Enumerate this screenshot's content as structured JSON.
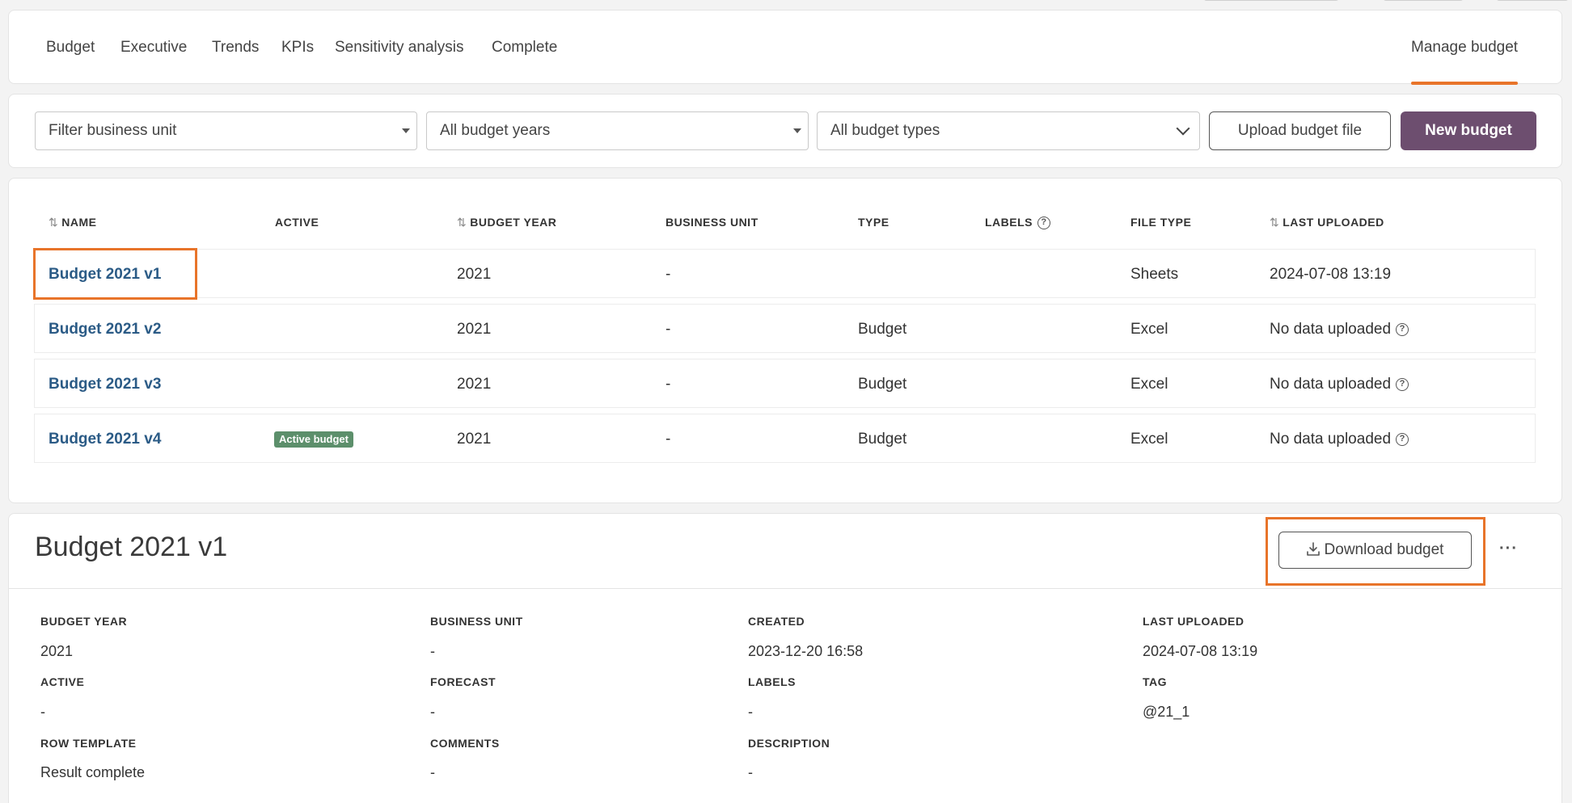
{
  "nav": {
    "tabs": [
      {
        "label": "Budget"
      },
      {
        "label": "Executive"
      },
      {
        "label": "Trends"
      },
      {
        "label": "KPIs"
      },
      {
        "label": "Sensitivity analysis"
      },
      {
        "label": "Complete"
      }
    ],
    "manage_label": "Manage budget"
  },
  "filters": {
    "business_unit": "Filter business unit",
    "budget_years": "All budget years",
    "budget_types": "All budget types",
    "upload_label": "Upload budget file",
    "new_label": "New budget"
  },
  "table": {
    "headers": {
      "name": "NAME",
      "active": "ACTIVE",
      "budget_year": "BUDGET YEAR",
      "business_unit": "BUSINESS UNIT",
      "type": "TYPE",
      "labels": "LABELS",
      "file_type": "FILE TYPE",
      "last_uploaded": "LAST UPLOADED"
    },
    "rows": [
      {
        "name": "Budget 2021 v1",
        "active": "",
        "year": "2021",
        "unit": "-",
        "type": "",
        "file_type": "Sheets",
        "last_uploaded": "2024-07-08 13:19"
      },
      {
        "name": "Budget 2021 v2",
        "active": "",
        "year": "2021",
        "unit": "-",
        "type": "Budget",
        "file_type": "Excel",
        "last_uploaded": "No data uploaded"
      },
      {
        "name": "Budget 2021 v3",
        "active": "",
        "year": "2021",
        "unit": "-",
        "type": "Budget",
        "file_type": "Excel",
        "last_uploaded": "No data uploaded"
      },
      {
        "name": "Budget 2021 v4",
        "active": "Active budget",
        "year": "2021",
        "unit": "-",
        "type": "Budget",
        "file_type": "Excel",
        "last_uploaded": "No data uploaded"
      }
    ]
  },
  "detail": {
    "title": "Budget 2021 v1",
    "download_label": "Download budget",
    "more_label": "···",
    "fields": {
      "budget_year": {
        "label": "BUDGET YEAR",
        "value": "2021"
      },
      "business_unit": {
        "label": "BUSINESS UNIT",
        "value": "-"
      },
      "created": {
        "label": "CREATED",
        "value": "2023-12-20 16:58"
      },
      "last_uploaded": {
        "label": "LAST UPLOADED",
        "value": "2024-07-08 13:19"
      },
      "active": {
        "label": "ACTIVE",
        "value": "-"
      },
      "forecast": {
        "label": "FORECAST",
        "value": "-"
      },
      "labels": {
        "label": "LABELS",
        "value": "-"
      },
      "tag": {
        "label": "TAG",
        "value": "@21_1"
      },
      "row_template": {
        "label": "ROW TEMPLATE",
        "value": "Result complete"
      },
      "comments": {
        "label": "COMMENTS",
        "value": "-"
      },
      "description": {
        "label": "DESCRIPTION",
        "value": "-"
      }
    }
  },
  "colors": {
    "accent": "#e8742a",
    "primary_button": "#6d4e6f",
    "link": "#2b5b86",
    "badge": "#5c8f6b"
  }
}
